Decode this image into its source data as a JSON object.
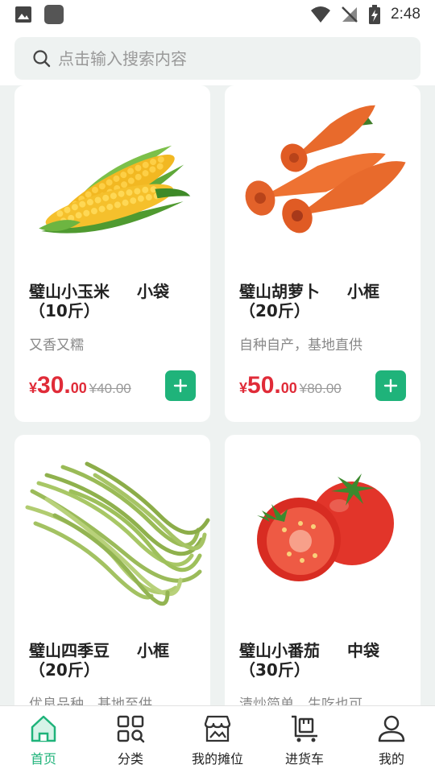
{
  "status_bar": {
    "time": "2:48"
  },
  "search": {
    "placeholder": "点击输入搜索内容"
  },
  "colors": {
    "accent": "#1fb37a",
    "price": "#e02b38",
    "background": "#eef2f1"
  },
  "products": [
    {
      "name": "璧山小玉米",
      "unit": "小袋",
      "weight": "（10斤）",
      "desc": "又香又糯",
      "currency": "¥",
      "price_int": "30.",
      "price_dec": "00",
      "orig_price": "¥40.00",
      "image": "corn"
    },
    {
      "name": "璧山胡萝卜",
      "unit": "小框",
      "weight": "（20斤）",
      "desc": "自种自产，基地直供",
      "currency": "¥",
      "price_int": "50.",
      "price_dec": "00",
      "orig_price": "¥80.00",
      "image": "carrot"
    },
    {
      "name": "璧山四季豆",
      "unit": "小框",
      "weight": "（20斤）",
      "desc": "优良品种，基地至供",
      "image": "green-beans"
    },
    {
      "name": "璧山小番茄",
      "unit": "中袋",
      "weight": "（30斤）",
      "desc": "清炒简单，生吃也可",
      "image": "tomato"
    }
  ],
  "tabs": [
    {
      "label": "首页",
      "icon": "home-icon",
      "active": true
    },
    {
      "label": "分类",
      "icon": "category-icon",
      "active": false
    },
    {
      "label": "我的摊位",
      "icon": "stall-icon",
      "active": false
    },
    {
      "label": "进货车",
      "icon": "cart-icon",
      "active": false
    },
    {
      "label": "我的",
      "icon": "user-icon",
      "active": false
    }
  ]
}
